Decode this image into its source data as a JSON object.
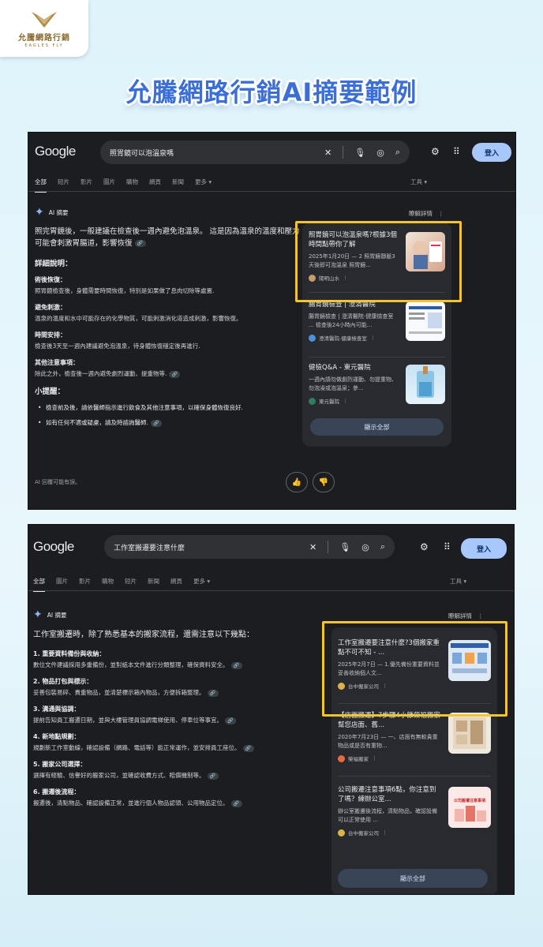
{
  "brand": {
    "name": "允騰網路行銷",
    "sub": "EAGLES FLY",
    "page_title": "允騰網路行銷AI摘要範例"
  },
  "screen1": {
    "logo": "Google",
    "query": "照胃鏡可以泡溫泉嗎",
    "login": "登入",
    "tabs": [
      "全部",
      "短片",
      "影片",
      "圖片",
      "購物",
      "網頁",
      "新聞",
      "更多 ▾"
    ],
    "tools": "工具 ▾",
    "ai_label": "AI 摘要",
    "learn_more": "瞭解詳情",
    "lead": "照完胃鏡後，一般建議在檢查後一週內避免泡溫泉。 這是因為溫泉的溫度和壓力可能會刺激胃腸道，影響恢復",
    "detail_title": "詳細說明：",
    "details": [
      {
        "h": "術後恢復：",
        "t": "照胃鏡檢查後，身體需要時間恢復，特別是如果做了息肉切除等處置."
      },
      {
        "h": "避免刺激：",
        "t": "溫泉的溫度和水中可能存在的化學物質，可能刺激消化道造成刺激，影響恢復。"
      },
      {
        "h": "時間安排：",
        "t": "檢查後3天至一週內建議避免泡溫泉，待身體恢復穩定後再進行."
      },
      {
        "h": "其他注意事項：",
        "t": "除此之外，檢查後一週內避免劇烈運動、提重物等."
      }
    ],
    "tips_title": "小提醒：",
    "tips": [
      "檢查前及後，請依醫師指示進行飲食及其他注意事項，以確保身體恢復良好.",
      "如有任何不適或疑慮，請及時諮詢醫師."
    ],
    "disclaimer": "AI 回覆可能有誤。",
    "cards": [
      {
        "title": "照胃鏡可以泡溫泉嗎?根據3個時間點帶你了解",
        "desc": "2025年1月20日 — 2 照胃鏡靜脈3天後即可泡溫泉 照胃鏡...",
        "src": "陽明山水"
      },
      {
        "title": "腸胃鏡檢查 | 澄清醫院",
        "desc": "腸胃鏡檢查 | 澄清醫院-健康檢查室 ... 檢查後24小時內可能...",
        "src": "澄清醫院-健康檢查室"
      },
      {
        "title": "健檢Q&A - 東元醫院",
        "desc": "一週內請勿做劇烈運動、勿提重物、勿泡澡或泡溫泉；參...",
        "src": "東元醫院"
      }
    ],
    "show_all": "顯示全部"
  },
  "screen2": {
    "logo": "Google",
    "query": "工作室搬遷要注意什麼",
    "login": "登入",
    "tabs": [
      "全部",
      "圖片",
      "影片",
      "購物",
      "短片",
      "新聞",
      "網頁",
      "更多 ▾"
    ],
    "tools": "工具 ▾",
    "ai_label": "AI 摘要",
    "learn_more": "瞭解詳情",
    "lead": "工作室搬遷時，除了熟悉基本的搬家流程，還需注意以下幾點：",
    "items": [
      {
        "h": "1. 重要資料備份與收納：",
        "t": "數位文件建議採用多重備份，並對紙本文件進行分類整理，確保資料安全。"
      },
      {
        "h": "2. 物品打包與標示：",
        "t": "妥善包裝易碎、貴重物品，並清楚標示箱內物品，方便拆箱整理。"
      },
      {
        "h": "3. 溝通與協調：",
        "t": "提前告知員工搬遷日期，並與大樓管理員協調電梯使用、停車位等事宜。"
      },
      {
        "h": "4. 新地點規劃：",
        "t": "規劃新工作室動線，確認設備（網路、電話等）能正常運作，並安排員工座位。"
      },
      {
        "h": "5. 搬家公司選擇：",
        "t": "選擇有經驗、信譽好的搬家公司，並確認收費方式、賠償機制等。"
      },
      {
        "h": "6. 搬遷後流程：",
        "t": "搬遷後，清點物品、確認設備正常，並進行個人物品認領、公用物品定位。"
      }
    ],
    "cards": [
      {
        "title": "工作室搬遷要注意什麼?3個搬家重點不可不知 - ...",
        "desc": "2025年2月7日 — 1.優先備份重要資料並妥善收納個人文...",
        "src": "台中搬家公司"
      },
      {
        "title": "【店面搬遷】7步驟4小節榮福搬家幫您店面、舊...",
        "desc": "2020年7月23日 — 一、店面有無較貴重物品或是否有重物...",
        "src": "榮福搬家"
      },
      {
        "title": "公司搬遷注意事項6點，你注意到了嗎？練辦公室...",
        "desc": "辦公室搬遷後流程，清點物品，確認設備可以正常使用 ...",
        "src": "台中搬家公司"
      }
    ],
    "card2_img_text": "公司搬遷注意事項",
    "show_all": "顯示全部"
  },
  "colors": {
    "accent": "#f4c430",
    "title_blue": "#3a6fd8",
    "panel_bg": "#1c1d21"
  }
}
